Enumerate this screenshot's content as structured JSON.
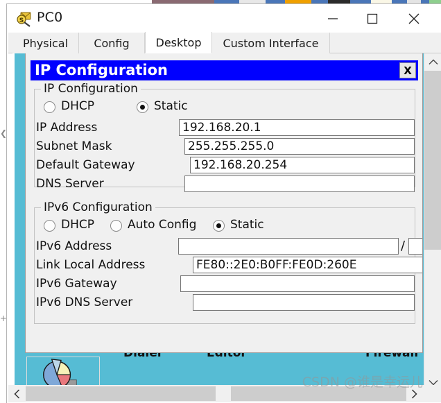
{
  "window": {
    "title": "PC0",
    "icon": "pc-magnifier-icon",
    "controls": {
      "minimize": "minimize-icon",
      "maximize": "maximize-icon",
      "close": "close-icon"
    }
  },
  "tabs": [
    {
      "label": "Physical",
      "active": false
    },
    {
      "label": "Config",
      "active": false
    },
    {
      "label": "Desktop",
      "active": true
    },
    {
      "label": "Custom Interface",
      "active": false
    }
  ],
  "dialog": {
    "title": "IP Configuration",
    "close_label": "X",
    "title_bg": "#0000ff",
    "title_fg": "#ffffff",
    "ipv4": {
      "legend": "IP Configuration",
      "modes": [
        {
          "label": "DHCP",
          "selected": false
        },
        {
          "label": "Static",
          "selected": true
        }
      ],
      "fields": [
        {
          "label": "IP Address",
          "value": "192.168.20.1"
        },
        {
          "label": "Subnet Mask",
          "value": "255.255.255.0"
        },
        {
          "label": "Default Gateway",
          "value": "192.168.20.254"
        },
        {
          "label": "DNS Server",
          "value": ""
        }
      ]
    },
    "ipv6": {
      "legend": "IPv6 Configuration",
      "modes": [
        {
          "label": "DHCP",
          "selected": false
        },
        {
          "label": "Auto Config",
          "selected": false
        },
        {
          "label": "Static",
          "selected": true
        }
      ],
      "address_label": "IPv6 Address",
      "address_value": "",
      "prefix_separator": "/",
      "prefix_value": "",
      "fields": [
        {
          "label": "Link Local Address",
          "value": "FE80::2E0:B0FF:FE0D:260E"
        },
        {
          "label": "IPv6 Gateway",
          "value": ""
        },
        {
          "label": "IPv6 DNS Server",
          "value": ""
        }
      ]
    }
  },
  "desktop": {
    "background": "#56bcd4",
    "clipped_icon_labels": [
      "Dialer",
      "Editor",
      "Firewall"
    ],
    "visible_icon": "pie-chart-traffic-generator-icon"
  },
  "scrollbars": {
    "vertical": {
      "up": "chevron-up-icon",
      "down": "chevron-down-icon"
    },
    "horizontal": {
      "left": "chevron-left-icon",
      "right": "chevron-right-icon"
    }
  },
  "watermark": "CSDN @谁是幸运儿"
}
